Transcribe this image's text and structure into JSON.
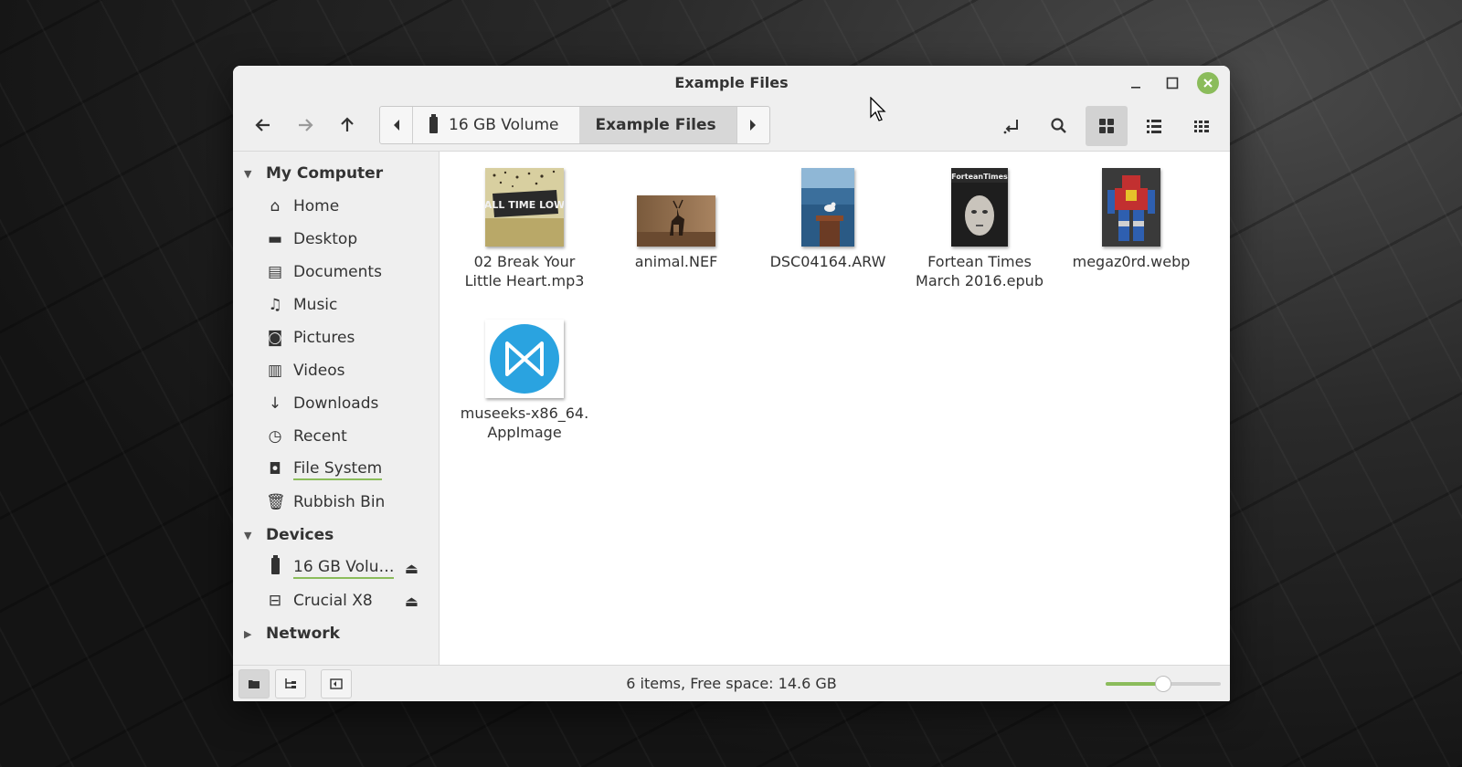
{
  "window": {
    "title": "Example Files"
  },
  "toolbar": {
    "path": [
      {
        "label": "16 GB Volume",
        "icon": "usb-drive-icon",
        "active": false
      },
      {
        "label": "Example Files",
        "icon": "",
        "active": true
      }
    ],
    "view_mode": "icon-view"
  },
  "sidebar": {
    "sections": [
      {
        "title": "My Computer",
        "expanded": true,
        "items": [
          {
            "label": "Home",
            "icon": "home-icon"
          },
          {
            "label": "Desktop",
            "icon": "desktop-icon"
          },
          {
            "label": "Documents",
            "icon": "documents-icon"
          },
          {
            "label": "Music",
            "icon": "music-icon"
          },
          {
            "label": "Pictures",
            "icon": "camera-icon"
          },
          {
            "label": "Videos",
            "icon": "film-icon"
          },
          {
            "label": "Downloads",
            "icon": "download-icon"
          },
          {
            "label": "Recent",
            "icon": "clock-icon"
          },
          {
            "label": "File System",
            "icon": "harddisk-icon"
          },
          {
            "label": "Rubbish Bin",
            "icon": "trash-icon"
          }
        ]
      },
      {
        "title": "Devices",
        "expanded": true,
        "items": [
          {
            "label": "16 GB Volu…",
            "icon": "usb-drive-icon",
            "eject": true
          },
          {
            "label": "Crucial X8",
            "icon": "external-drive-icon",
            "eject": true
          }
        ]
      },
      {
        "title": "Network",
        "expanded": false,
        "items": []
      }
    ]
  },
  "files": [
    {
      "name_line1": "02 Break Your",
      "name_line2": "Little Heart.mp3",
      "type": "audio-cover"
    },
    {
      "name_line1": "animal.NEF",
      "name_line2": "",
      "type": "photo-deer"
    },
    {
      "name_line1": "DSC04164.ARW",
      "name_line2": "",
      "type": "photo-seagull"
    },
    {
      "name_line1": "Fortean Times",
      "name_line2": "March 2016.epub",
      "type": "magazine-cover"
    },
    {
      "name_line1": "megaz0rd.webp",
      "name_line2": "",
      "type": "photo-robot"
    },
    {
      "name_line1": "museeks-x86_64.",
      "name_line2": "AppImage",
      "type": "app-icon"
    }
  ],
  "status": {
    "text": "6 items, Free space: 14.6 GB",
    "zoom_fraction": 0.5
  },
  "colors": {
    "accent": "#8bbc5b",
    "app_icon": "#2aa3e0"
  },
  "thumbs": {
    "album_band": "ALL TIME LOW",
    "magazine_title": "ForteanTimes"
  }
}
